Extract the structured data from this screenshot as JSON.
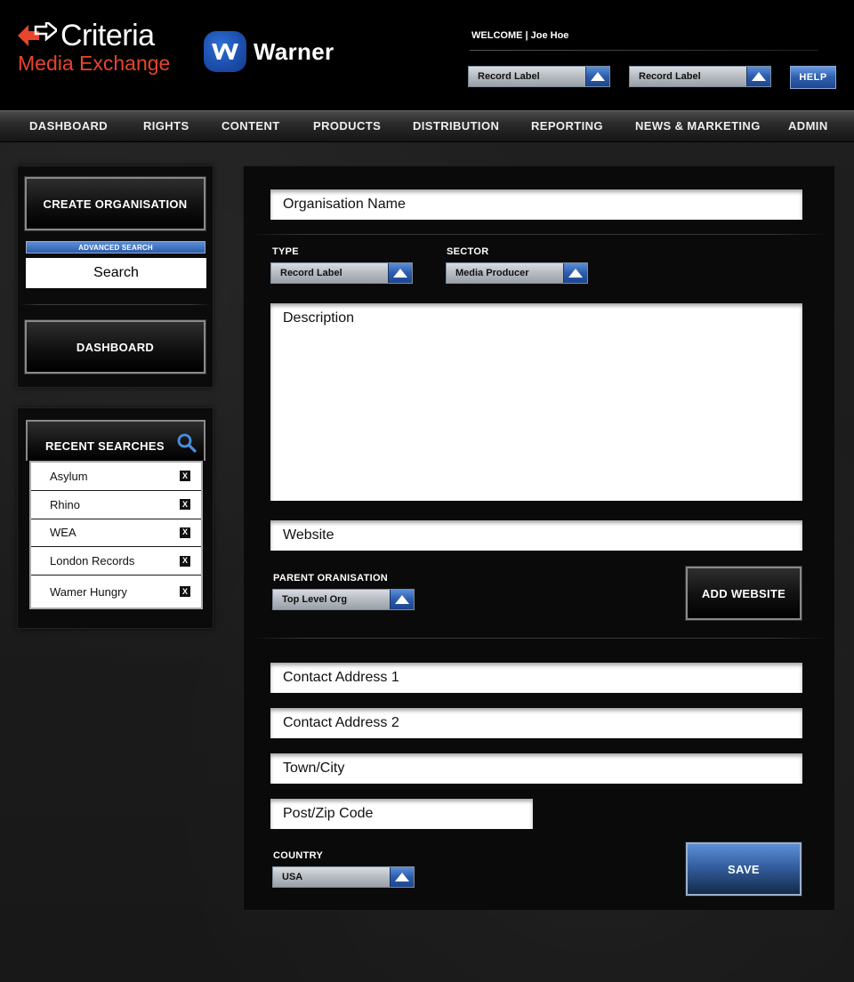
{
  "header": {
    "brand_name": "Criteria",
    "brand_sub": "Media Exchange",
    "partner_name": "Warner",
    "welcome_text": "WELCOME | Joe Hoe",
    "select_1": "Record Label",
    "select_2": "Record Label",
    "help_label": "HELP"
  },
  "nav": {
    "items": [
      "DASHBOARD",
      "RIGHTS",
      "CONTENT",
      "PRODUCTS",
      "DISTRIBUTION",
      "REPORTING",
      "NEWS & MARKETING",
      "ADMIN"
    ]
  },
  "sidebar": {
    "create_org_label": "CREATE ORGANISATION",
    "advanced_search_label": "ADVANCED SEARCH",
    "search_value": "Search",
    "dashboard_label": "DASHBOARD",
    "recent_title": "RECENT SEARCHES",
    "recent_items": [
      "Asylum",
      "Rhino",
      "WEA",
      "London Records",
      "Wamer Hungry"
    ],
    "remove_glyph": "X"
  },
  "form": {
    "org_name_placeholder": "Organisation Name",
    "type_label": "TYPE",
    "type_value": "Record Label",
    "sector_label": "SECTOR",
    "sector_value": "Media Producer",
    "description_placeholder": "Description",
    "website_placeholder": "Website",
    "parent_label": "PARENT ORANISATION",
    "parent_value": "Top Level Org",
    "add_website_label": "ADD WEBSITE",
    "address1_placeholder": "Contact Address 1",
    "address2_placeholder": "Contact Address 2",
    "city_placeholder": "Town/City",
    "zip_placeholder": "Post/Zip Code",
    "country_label": "COUNTRY",
    "country_value": "USA",
    "save_label": "SAVE"
  },
  "colors": {
    "accent_blue": "#2c5cab",
    "brand_red": "#e8452c",
    "background": "#1c1c1c"
  }
}
